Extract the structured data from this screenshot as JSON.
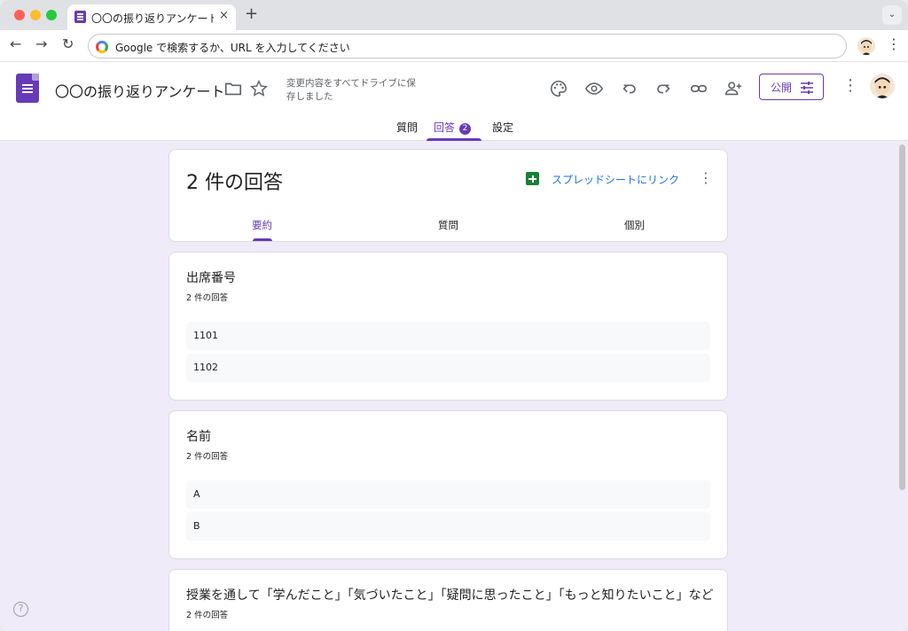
{
  "browser": {
    "tab_title": "〇〇の振り返りアンケート - Google フォーム",
    "tab_close": "×",
    "new_tab": "+",
    "tab_dropdown": "⌄",
    "nav_back": "←",
    "nav_forward": "→",
    "nav_reload": "↻",
    "omnibox_placeholder": "Google で検索するか、URL を入力してください",
    "menu": "⋮"
  },
  "header": {
    "form_title": "〇〇の振り返りアンケート",
    "save_status": "変更内容をすべてドライブに保存しました",
    "publish_label": "公開",
    "more": "⋮",
    "accent_color": "#673ab7"
  },
  "main_tabs": {
    "questions": "質問",
    "responses": "回答",
    "responses_count": "2",
    "settings": "設定"
  },
  "summary": {
    "title": "2 件の回答",
    "sheet_link": "スプレッドシートにリンク",
    "more": "⋮",
    "tabs": {
      "summary": "要約",
      "question": "質問",
      "individual": "個別"
    }
  },
  "questions": [
    {
      "title": "出席番号",
      "count": "2 件の回答",
      "answers": [
        "1101",
        "1102"
      ]
    },
    {
      "title": "名前",
      "count": "2 件の回答",
      "answers": [
        "A",
        "B"
      ]
    },
    {
      "title": "授業を通して「学んだこと」「気づいたこと」「疑問に思ったこと」「もっと知りたいこと」など",
      "count": "2 件の回答",
      "answers": []
    }
  ],
  "help": "?"
}
